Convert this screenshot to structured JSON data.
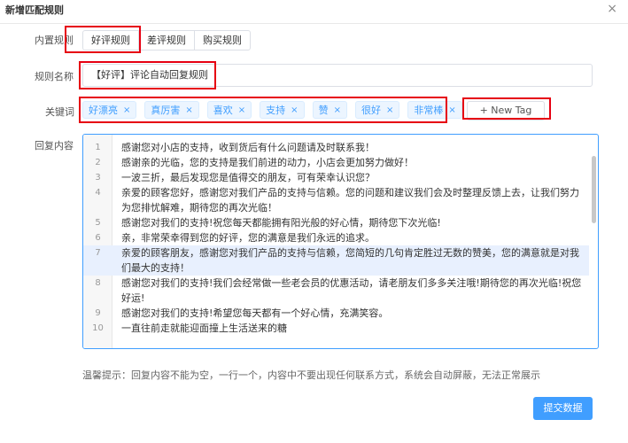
{
  "dialog": {
    "title": "新增匹配规则",
    "close": "×"
  },
  "labels": {
    "builtin_rules": "内置规则",
    "rule_name": "规则名称",
    "keywords": "关键词",
    "reply_content": "回复内容"
  },
  "builtin_rules": [
    {
      "label": "好评规则",
      "selected": true
    },
    {
      "label": "差评规则",
      "selected": false
    },
    {
      "label": "购买规则",
      "selected": false
    }
  ],
  "rule_name_value": "【好评】评论自动回复规则",
  "keywords": [
    "好漂亮",
    "真厉害",
    "喜欢",
    "支持",
    "赞",
    "很好",
    "非常棒"
  ],
  "tag_close": "×",
  "new_tag_label": "+ New Tag",
  "editor_lines": [
    {
      "no": "1",
      "text": "感谢您对小店的支持，收到货后有什么问题请及时联系我！"
    },
    {
      "no": "2",
      "text": "感谢亲的光临，您的支持是我们前进的动力，小店会更加努力做好！"
    },
    {
      "no": "3",
      "text": "一波三折，最后发现您是值得交的朋友，可有荣幸认识您？"
    },
    {
      "no": "4",
      "text": "亲爱的顾客您好，感谢您对我们产品的支持与信赖。您的问题和建议我们会及时整理反馈上去，让我们努力为您排忧解难，期待您的再次光临！"
    },
    {
      "no": "5",
      "text": "感谢您对我们的支持!祝您每天都能拥有阳光般的好心情，期待您下次光临!"
    },
    {
      "no": "6",
      "text": "亲，非常荣幸得到您的好评，您的满意是我们永远的追求。"
    },
    {
      "no": "7",
      "text": "亲爱的顾客朋友，感谢您对我们产品的支持与信赖，您简短的几句肯定胜过无数的赞美，您的满意就是对我们最大的支持！"
    },
    {
      "no": "8",
      "text": "感谢您对我们的支持!我们会经常做一些老会员的优惠活动，请老朋友们多多关注哦!期待您的再次光临!祝您好运!"
    },
    {
      "no": "9",
      "text": "感谢您对我们的支持!希望您每天都有一个好心情，充满笑容。"
    },
    {
      "no": "10",
      "text": "一直往前走就能迎面撞上生活送来的糖"
    }
  ],
  "hint": "温馨提示：回复内容不能为空，一行一个，内容中不要出现任何联系方式，系统会自动屏蔽，无法正常展示",
  "submit_label": "提交数据",
  "colors": {
    "primary": "#409eff",
    "annotation": "#e60012",
    "active_line": "#e8f0fe"
  }
}
